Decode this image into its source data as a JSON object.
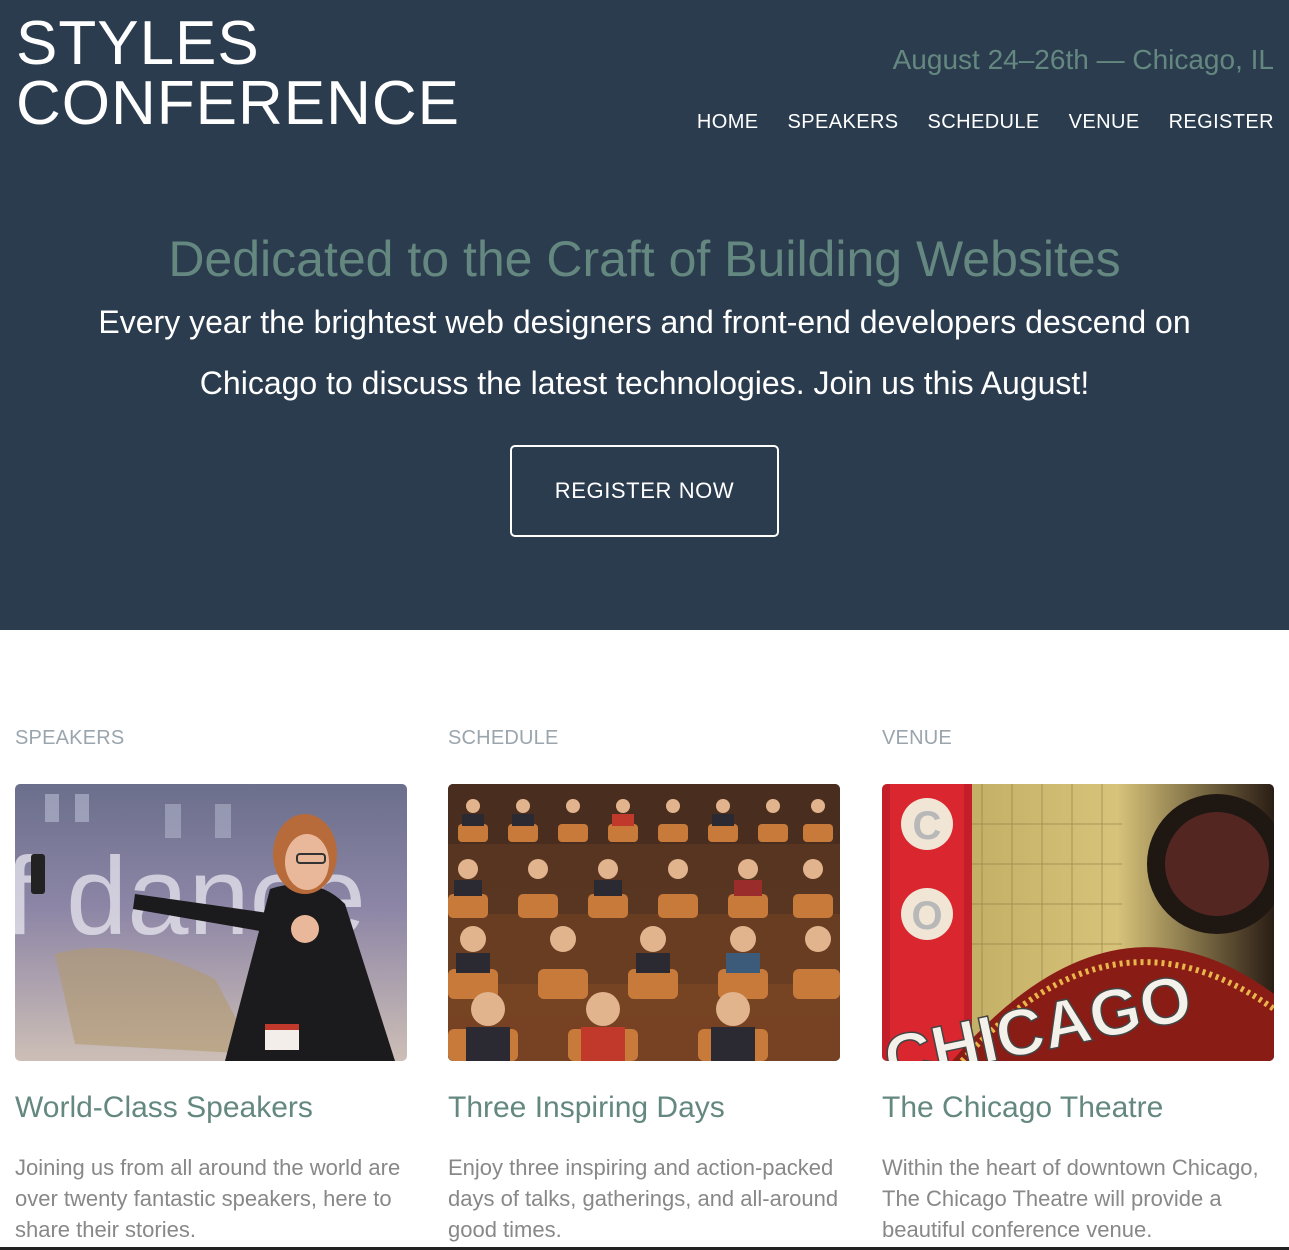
{
  "header": {
    "logo_line1": "STYLES",
    "logo_line2": "CONFERENCE",
    "tagline": "August 24–26th — Chicago, IL",
    "nav": [
      {
        "label": "HOME"
      },
      {
        "label": "SPEAKERS"
      },
      {
        "label": "SCHEDULE"
      },
      {
        "label": "VENUE"
      },
      {
        "label": "REGISTER"
      }
    ]
  },
  "hero": {
    "title": "Dedicated to the Craft of Building Websites",
    "lead": "Every year the brightest web designers and front-end developers descend on Chicago to discuss the latest technologies. Join us this August!",
    "button_label": "REGISTER NOW"
  },
  "teasers": [
    {
      "label": "SPEAKERS",
      "image": "speaker-photo",
      "title": "World-Class Speakers",
      "text": "Joining us from all around the world are over twenty fantastic speakers, here to share their stories."
    },
    {
      "label": "SCHEDULE",
      "image": "audience-photo",
      "title": "Three Inspiring Days",
      "text": "Enjoy three inspiring and action-packed days of talks, gatherings, and all-around good times."
    },
    {
      "label": "VENUE",
      "image": "chicago-theatre-photo",
      "title": "The Chicago Theatre",
      "text": "Within the heart of downtown Chicago, The Chicago Theatre will provide a beautiful conference venue."
    }
  ],
  "colors": {
    "hero_bg": "#2b3c4e",
    "accent": "#648880",
    "muted_label": "#9aa5ad",
    "body_text": "#888888"
  }
}
